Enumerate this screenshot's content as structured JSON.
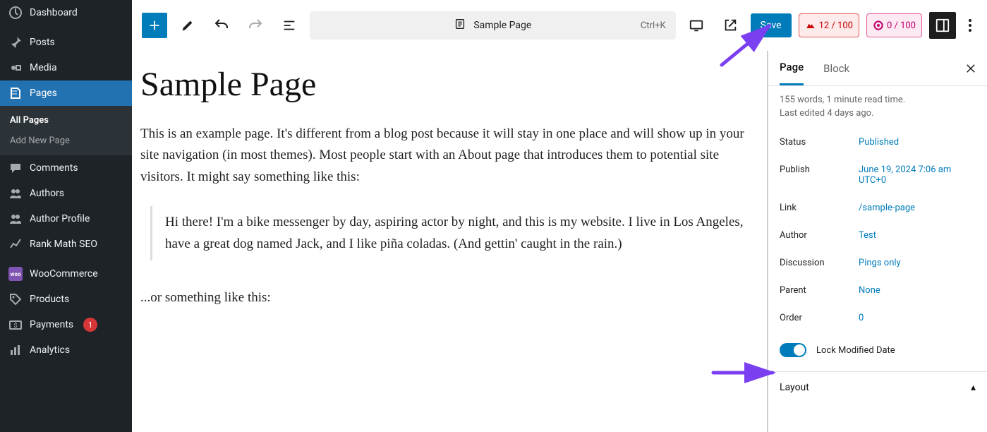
{
  "sidebar": {
    "items": [
      {
        "icon": "dashboard-icon",
        "label": "Dashboard"
      },
      {
        "icon": "pin-icon",
        "label": "Posts"
      },
      {
        "icon": "media-icon",
        "label": "Media"
      },
      {
        "icon": "page-icon",
        "label": "Pages",
        "active": true
      },
      {
        "icon": "comment-icon",
        "label": "Comments"
      },
      {
        "icon": "users-icon",
        "label": "Authors"
      },
      {
        "icon": "users-icon",
        "label": "Author Profile"
      },
      {
        "icon": "chart-icon",
        "label": "Rank Math SEO"
      },
      {
        "icon": "woo-icon",
        "label": "WooCommerce"
      },
      {
        "icon": "tag-icon",
        "label": "Products"
      },
      {
        "icon": "payment-icon",
        "label": "Payments",
        "badge": "1"
      },
      {
        "icon": "analytics-icon",
        "label": "Analytics"
      }
    ],
    "submenu": [
      {
        "label": "All Pages",
        "current": true
      },
      {
        "label": "Add New Page"
      }
    ]
  },
  "topbar": {
    "doc_title": "Sample Page",
    "shortcut": "Ctrl+K",
    "save_label": "Save",
    "seo1": "12 / 100",
    "seo2": "0 / 100"
  },
  "editor": {
    "title": "Sample Page",
    "p1": "This is an example page. It's different from a blog post because it will stay in one place and will show up in your site navigation (in most themes). Most people start with an About page that introduces them to potential site visitors. It might say something like this:",
    "quote": "Hi there! I'm a bike messenger by day, aspiring actor by night, and this is my website. I live in Los Angeles, have a great dog named Jack, and I like piña coladas. (And gettin' caught in the rain.)",
    "p2": "...or something like this:"
  },
  "panel": {
    "tabs": {
      "page": "Page",
      "block": "Block"
    },
    "summary1": "155 words, 1 minute read time.",
    "summary2": "Last edited 4 days ago.",
    "rows": {
      "status_k": "Status",
      "status_v": "Published",
      "publish_k": "Publish",
      "publish_v": "June 19, 2024 7:06 am UTC+0",
      "link_k": "Link",
      "link_v": "/sample-page",
      "author_k": "Author",
      "author_v": "Test",
      "discussion_k": "Discussion",
      "discussion_v": "Pings only",
      "parent_k": "Parent",
      "parent_v": "None",
      "order_k": "Order",
      "order_v": "0"
    },
    "lock_label": "Lock Modified Date",
    "section_layout": "Layout"
  }
}
